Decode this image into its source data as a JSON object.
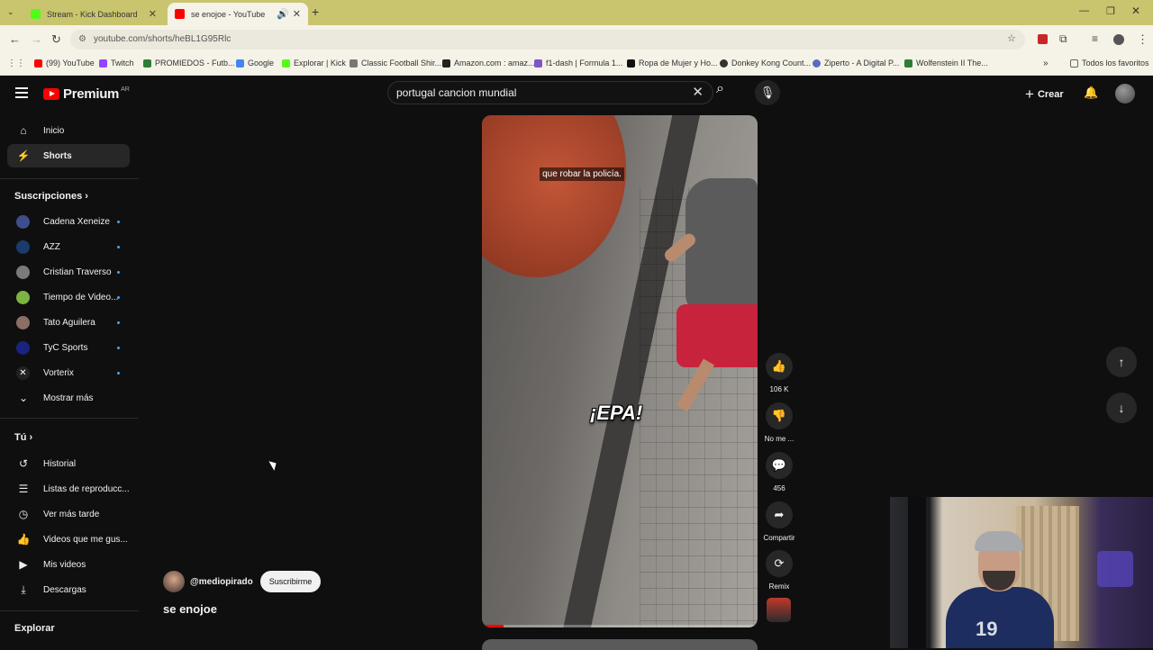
{
  "browser": {
    "tabs": [
      {
        "label": "Stream - Kick Dashboard",
        "favicon_color": "#53fc18"
      },
      {
        "label": "se enojoe - YouTube",
        "favicon_color": "#ff0000"
      }
    ],
    "url": "youtube.com/shorts/heBL1G95Rlc",
    "bookmarks": [
      {
        "label": "(99) YouTube",
        "color": "#ff0000"
      },
      {
        "label": "Twitch",
        "color": "#9146ff"
      },
      {
        "label": "PROMIEDOS - Futb...",
        "color": "#2e7d32"
      },
      {
        "label": "Google",
        "color": "#4285f4"
      },
      {
        "label": "Explorar | Kick",
        "color": "#53fc18"
      },
      {
        "label": "Classic Football Shir...",
        "color": "#777777"
      },
      {
        "label": "Amazon.com : amaz...",
        "color": "#222222"
      },
      {
        "label": "f1-dash | Formula 1...",
        "color": "#7e57c2"
      },
      {
        "label": "Ropa de Mujer y Ho...",
        "color": "#111111"
      },
      {
        "label": "Donkey Kong Count...",
        "color": "#333333"
      },
      {
        "label": "Ziperto - A Digital P...",
        "color": "#5c6bc0"
      },
      {
        "label": "Wolfenstein II The...",
        "color": "#2e7d32"
      }
    ],
    "all_bookmarks": "Todos los favoritos"
  },
  "header": {
    "logo_text": "Premium",
    "country": "AR",
    "search_value": "portugal cancion mundial",
    "create_label": "Crear"
  },
  "sidebar": {
    "main": [
      {
        "label": "Inicio",
        "icon": "home-icon"
      },
      {
        "label": "Shorts",
        "icon": "shorts-icon"
      }
    ],
    "subscriptions_title": "Suscripciones",
    "subscriptions": [
      {
        "label": "Cadena Xeneize",
        "color": "#3c4f8c"
      },
      {
        "label": "AZZ",
        "color": "#1b3b6f"
      },
      {
        "label": "Cristian Traverso",
        "color": "#7a7a7a"
      },
      {
        "label": "Tiempo de Video...",
        "color": "#7cb342"
      },
      {
        "label": "Tato Aguilera",
        "color": "#8d6e63"
      },
      {
        "label": "TyC Sports",
        "color": "#1a237e"
      },
      {
        "label": "Vorterix",
        "color": "#222222"
      }
    ],
    "show_more": "Mostrar más",
    "you_title": "Tú",
    "you_items": [
      {
        "label": "Historial",
        "icon": "history-icon"
      },
      {
        "label": "Listas de reproducc...",
        "icon": "playlist-icon"
      },
      {
        "label": "Ver más tarde",
        "icon": "clock-icon"
      },
      {
        "label": "Videos que me gus...",
        "icon": "like-icon"
      },
      {
        "label": "Mis videos",
        "icon": "video-icon"
      },
      {
        "label": "Descargas",
        "icon": "download-icon"
      }
    ],
    "explore_title": "Explorar"
  },
  "short": {
    "caption": "que robar la policía.",
    "overlay_text": "¡EPA!",
    "channel": "@mediopirado",
    "subscribe": "Suscribirme",
    "title": "se enojoe",
    "progress": 0.08
  },
  "actions": {
    "likes": "106 K",
    "dislike": "No me ...",
    "comments": "456",
    "share": "Compartir",
    "remix": "Remix"
  }
}
